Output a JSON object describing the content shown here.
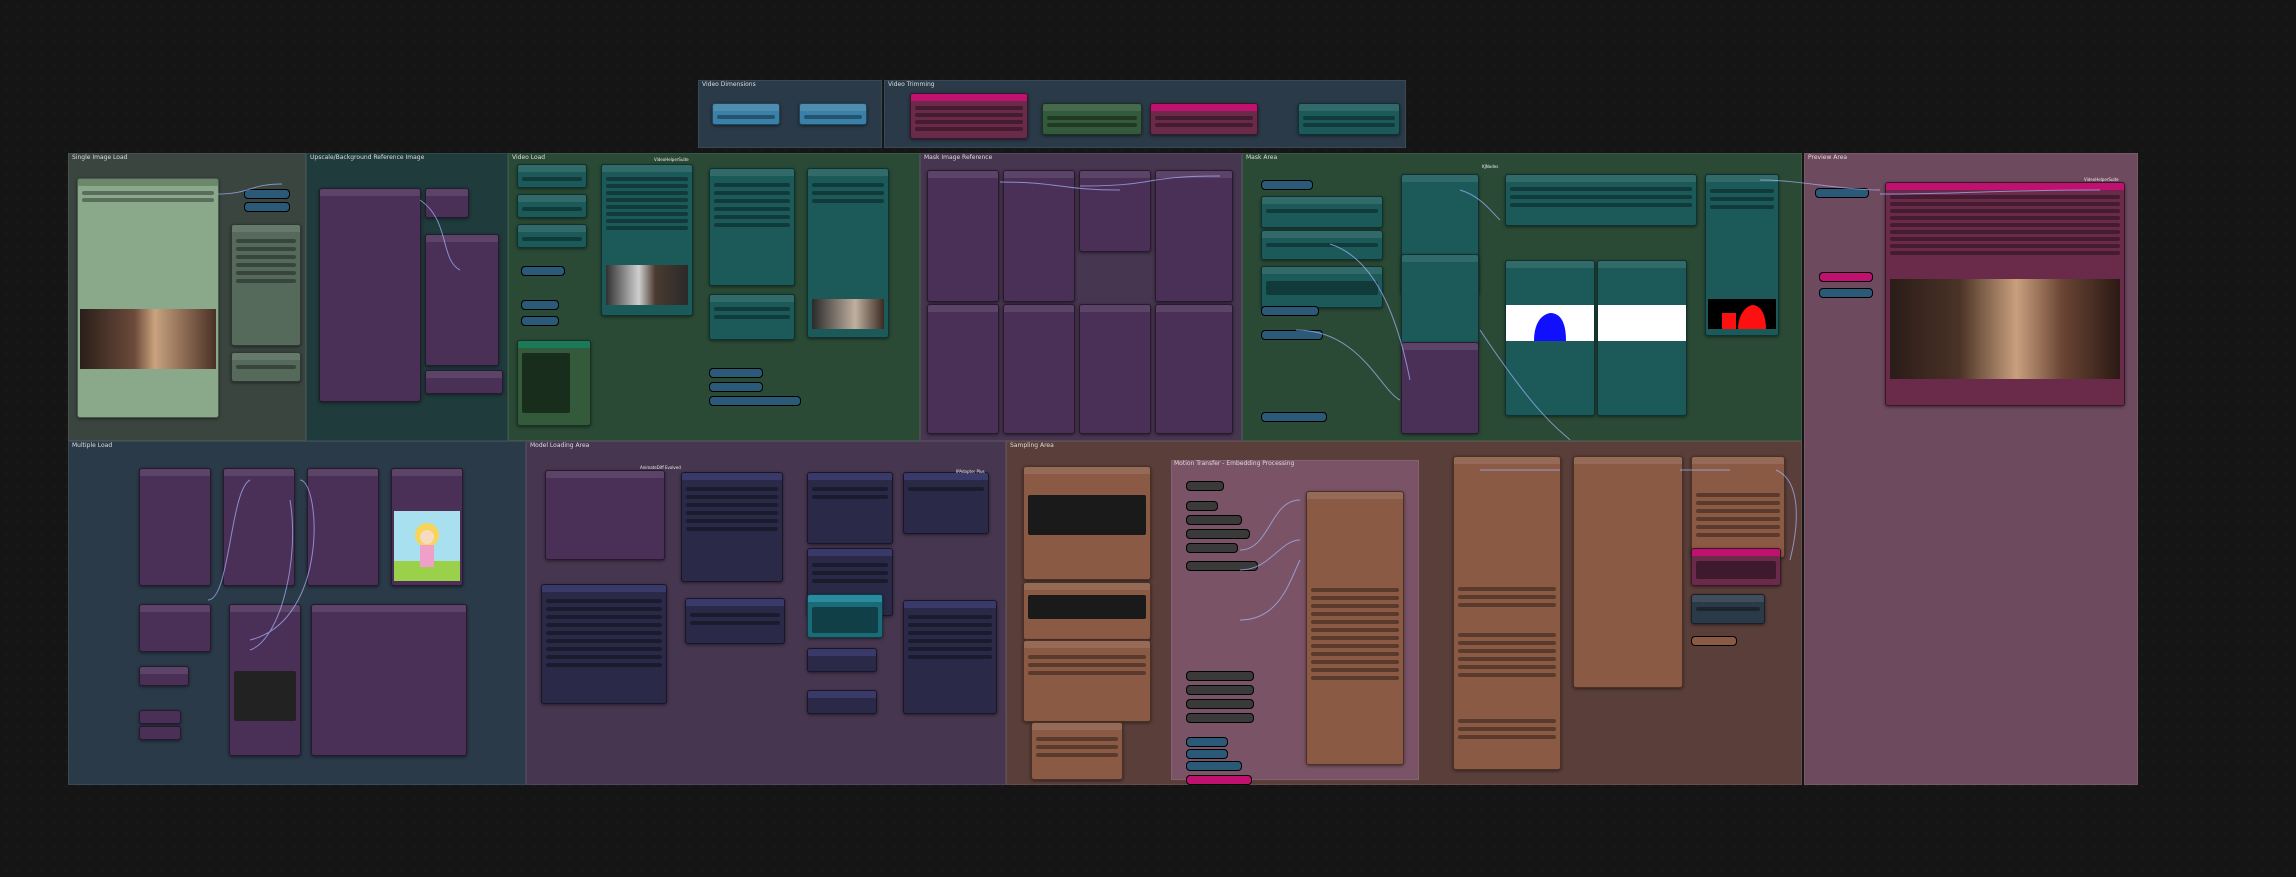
{
  "canvas": {
    "background": "#151515"
  },
  "colors": {
    "gray_group": "#3b4540",
    "teal_group": "#1f3b3c",
    "green_group": "#2a4a36",
    "blue_group": "#2a3a48",
    "purple_group": "#46364f",
    "orange_group": "#5a3e3a",
    "pink_group": "#6e4a5e",
    "node_purple": "#4a2f57",
    "node_teal": "#1b5a59",
    "node_blue": "#3a80a8",
    "node_magenta": "#c01070",
    "node_orange": "#8a5a44",
    "node_green": "#335a3a",
    "wire": "#a9b6ff"
  },
  "groups": [
    {
      "id": "video-dimensions",
      "title": "Video Dimensions"
    },
    {
      "id": "video-trim",
      "title": "Video Trimming"
    },
    {
      "id": "single-image-load",
      "title": "Single Image Load"
    },
    {
      "id": "upscale-reference",
      "title": "Upscale/Background Reference Image"
    },
    {
      "id": "video-load",
      "title": "Video Load"
    },
    {
      "id": "mask-image-reference",
      "title": "Mask Image Reference"
    },
    {
      "id": "mask-area",
      "title": "Mask Area"
    },
    {
      "id": "preview-area",
      "title": "Preview Area"
    },
    {
      "id": "multi-load",
      "title": "Multiple Load"
    },
    {
      "id": "model-loading",
      "title": "Model Loading Area"
    },
    {
      "id": "sampling-area",
      "title": "Sampling Area"
    },
    {
      "id": "motion-transfer",
      "title": "Motion Transfer - Embedding Processing"
    }
  ],
  "labels": {
    "video_combine": "VideoHelperSuite",
    "animatediff": "AnimateDiff Evolved",
    "kjnodes": "KJNodes",
    "ipadapter": "IPAdapter Plus"
  },
  "icons": [
    "image-thumbnail-icon",
    "cartoon-thumbnail-icon",
    "mask-preview-icon"
  ]
}
